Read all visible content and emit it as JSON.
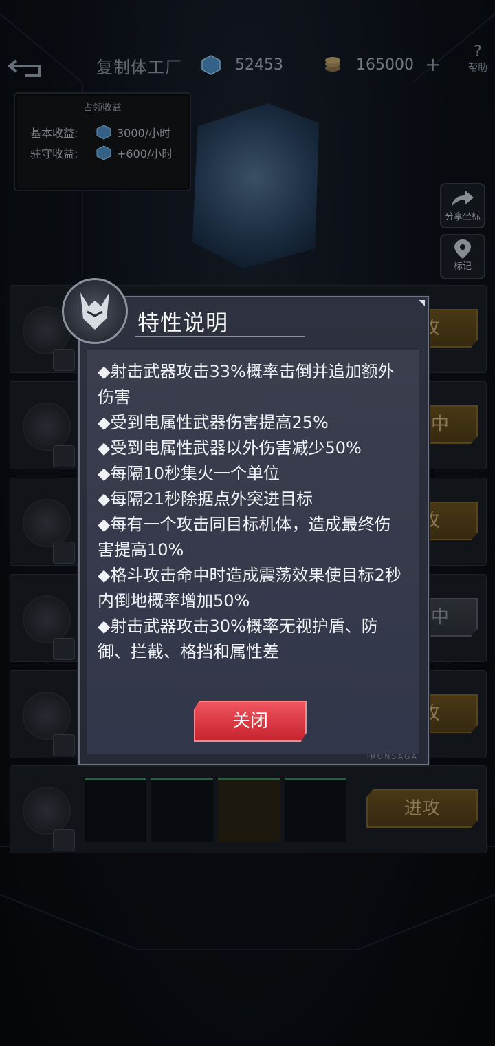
{
  "topbar": {
    "title": "复制体工厂",
    "crystal_count": "52453",
    "coin_count": "165000",
    "plus": "+",
    "help_icon": "?",
    "help_label": "帮助"
  },
  "income": {
    "header": "占领收益",
    "base_label": "基本收益:",
    "base_value": "3000/小时",
    "garrison_label": "驻守收益:",
    "garrison_value": "+600/小时"
  },
  "side": {
    "share_label": "分享坐标",
    "mark_label": "标记"
  },
  "rows": [
    {
      "action": "进攻"
    },
    {
      "action": "攻击中"
    },
    {
      "action": "进攻"
    },
    {
      "action": "攻击中"
    },
    {
      "action": "进攻"
    },
    {
      "action": "进攻"
    }
  ],
  "modal": {
    "title": "特性说明",
    "traits": [
      "◆射击武器攻击33%概率击倒并追加额外伤害",
      "◆受到电属性武器伤害提高25%",
      "◆受到电属性武器以外伤害减少50%",
      "◆每隔10秒集火一个单位",
      "◆每隔21秒除据点外突进目标",
      "◆每有一个攻击同目标机体，造成最终伤害提高10%",
      "◆格斗攻击命中时造成震荡效果使目标2秒内倒地概率增加50%",
      "◆射击武器攻击30%概率无视护盾、防御、拦截、格挡和属性差"
    ],
    "close_label": "关闭",
    "watermark": "IRONSAGA"
  },
  "colors": {
    "accent_gold": "#6b5320",
    "close_red": "#d8343d",
    "modal_bg": "#2e3240"
  }
}
